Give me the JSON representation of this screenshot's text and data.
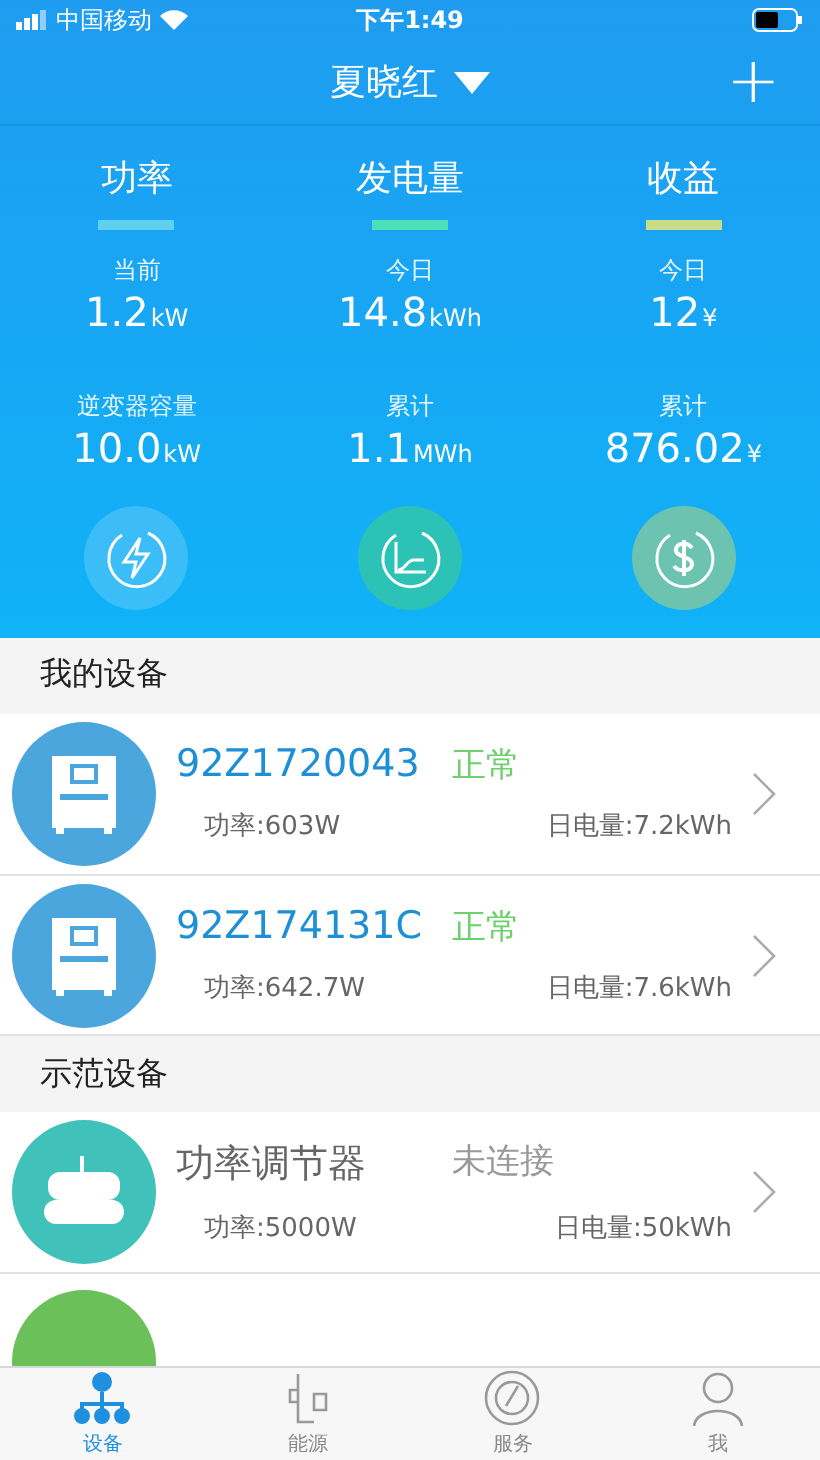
{
  "status_bar": {
    "carrier": "中国移动",
    "time": "下午1:49"
  },
  "nav": {
    "title": "夏晓红",
    "add": "+"
  },
  "stats": [
    {
      "kind": "power",
      "title": "功率",
      "color": "#5fd0f0",
      "items": [
        {
          "label": "当前",
          "value": "1.2",
          "unit": "kW"
        },
        {
          "label": "逆变器容量",
          "value": "10.0",
          "unit": "kW"
        }
      ]
    },
    {
      "kind": "energy",
      "title": "发电量",
      "color": "#4ee0b8",
      "items": [
        {
          "label": "今日",
          "value": "14.8",
          "unit": "kWh"
        },
        {
          "label": "累计",
          "value": "1.1",
          "unit": "MWh"
        }
      ]
    },
    {
      "kind": "income",
      "title": "收益",
      "color": "#c8dc8a",
      "items": [
        {
          "label": "今日",
          "value": "12",
          "unit": "¥"
        },
        {
          "label": "累计",
          "value": "876.02",
          "unit": "¥"
        }
      ]
    }
  ],
  "sections": [
    {
      "title": "我的设备",
      "devices": [
        {
          "kind": "inverter",
          "color": "#4aa6dc",
          "name": "92Z1720043",
          "status": "正常",
          "online": true,
          "power": "功率:603W",
          "energy": "日电量:7.2kWh"
        },
        {
          "kind": "inverter",
          "color": "#4aa6dc",
          "name": "92Z174131C",
          "status": "正常",
          "online": true,
          "power": "功率:642.7W",
          "energy": "日电量:7.6kWh"
        }
      ]
    },
    {
      "title": "示范设备",
      "devices": [
        {
          "kind": "router",
          "color": "#40c2bb",
          "name": "功率调节器",
          "status": "未连接",
          "online": false,
          "power": "功率:5000W",
          "energy": "日电量:50kWh"
        },
        {
          "kind": "partial",
          "color": "#6cc05a"
        }
      ]
    }
  ],
  "tabs": [
    {
      "kind": "devices",
      "label": "设备",
      "selected": true
    },
    {
      "kind": "energy",
      "label": "能源",
      "selected": false
    },
    {
      "kind": "service",
      "label": "服务",
      "selected": false
    },
    {
      "kind": "me",
      "label": "我",
      "selected": false
    }
  ]
}
